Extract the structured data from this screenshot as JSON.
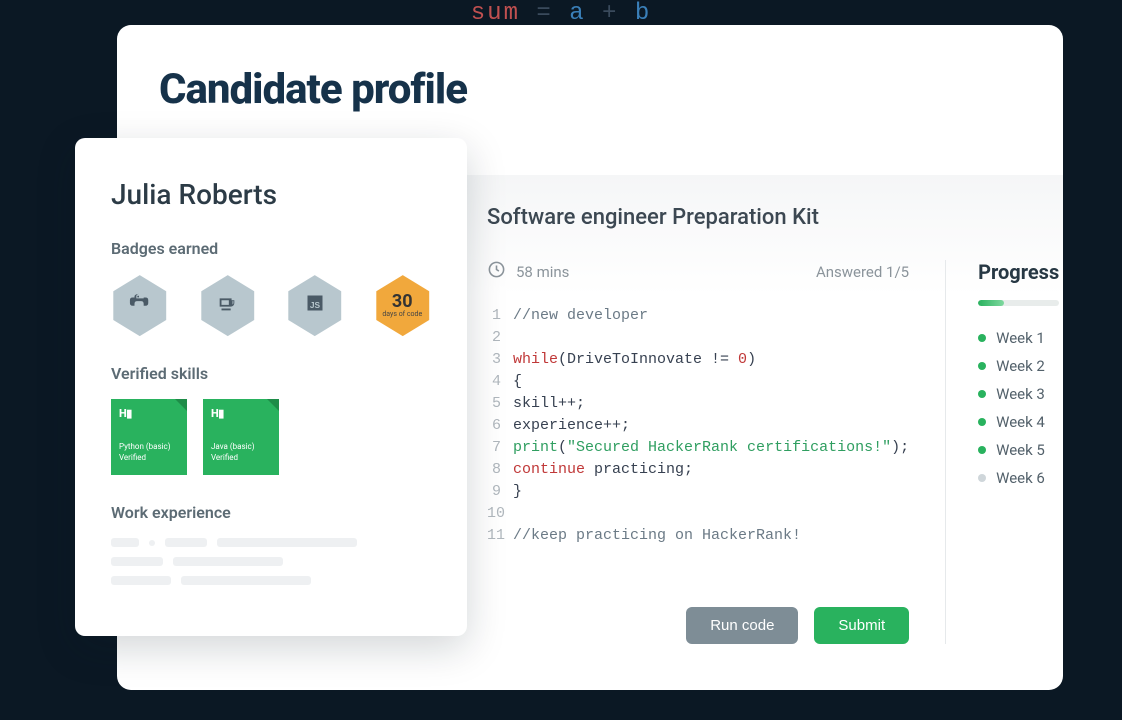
{
  "bg_code": {
    "lhs": "sum",
    "eq": "=",
    "a": "a",
    "plus": "+",
    "b": "b"
  },
  "page_title": "Candidate profile",
  "profile": {
    "name": "Julia Roberts",
    "badges_label": "Badges earned",
    "badge30_num": "30",
    "badge30_sub": "days of code",
    "skills_label": "Verified skills",
    "skills": [
      {
        "logo": "H▮",
        "name": "Python (basic)",
        "verified": "Verified"
      },
      {
        "logo": "H▮",
        "name": "Java (basic)",
        "verified": "Verified"
      }
    ],
    "work_label": "Work experience"
  },
  "prep": {
    "title": "Software engineer Preparation Kit",
    "duration": "58 mins",
    "answered": "Answered 1/5",
    "run_label": "Run code",
    "submit_label": "Submit",
    "code": [
      {
        "n": "1",
        "html": "<span class='tok-comment'>//new developer</span>"
      },
      {
        "n": "2",
        "html": ""
      },
      {
        "n": "3",
        "html": "<span class='tok-kw'>while</span>(DriveToInnovate != <span class='tok-num'>0</span>)"
      },
      {
        "n": "4",
        "html": "{"
      },
      {
        "n": "5",
        "html": "skill++;"
      },
      {
        "n": "6",
        "html": "experience++;"
      },
      {
        "n": "7",
        "html": "<span class='tok-fn'>print</span>(<span class='tok-str'>\"Secured HackerRank certifications!\"</span>);"
      },
      {
        "n": "8",
        "html": "<span class='tok-kw'>continue</span> practicing;"
      },
      {
        "n": "9",
        "html": "}"
      },
      {
        "n": "10",
        "html": ""
      },
      {
        "n": "11",
        "html": "<span class='tok-comment'>//keep practicing on HackerRank!</span>"
      }
    ]
  },
  "progress": {
    "title": "Progress",
    "weeks": [
      {
        "label": "Week 1",
        "done": true
      },
      {
        "label": "Week 2",
        "done": true
      },
      {
        "label": "Week 3",
        "done": true
      },
      {
        "label": "Week 4",
        "done": true
      },
      {
        "label": "Week 5",
        "done": true
      },
      {
        "label": "Week 6",
        "done": false
      }
    ]
  }
}
